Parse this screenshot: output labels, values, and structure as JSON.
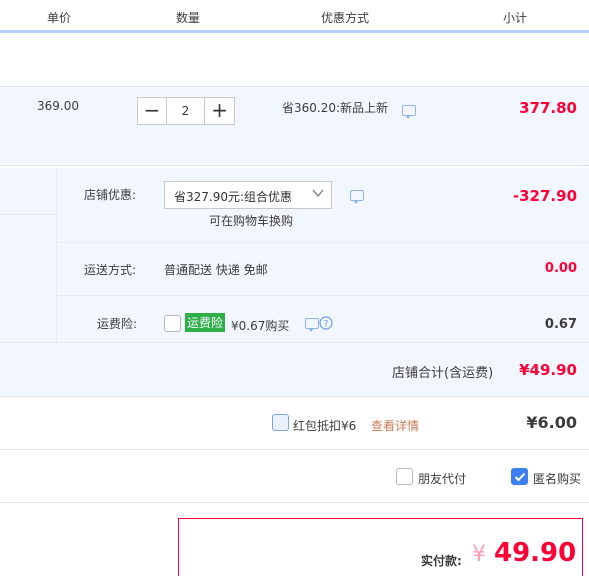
{
  "header": {
    "col_unit_price": "单价",
    "col_quantity": "数量",
    "col_discount": "优惠方式",
    "col_subtotal": "小计"
  },
  "item": {
    "unit_price": "369.00",
    "quantity": "2",
    "minus_label": "−",
    "plus_label": "+",
    "discount_text": "省360.20:新品上新",
    "subtotal": "377.80"
  },
  "shop": {
    "discount_label": "店铺优惠:",
    "discount_selected": "省327.90元:组合优惠",
    "discount_hint": "可在购物车换购",
    "discount_amount": "-327.90",
    "shipping_label": "运送方式:",
    "shipping_value": "普通配送 快递 免邮",
    "shipping_amount": "0.00",
    "insurance_label": "运费险:",
    "insurance_badge": "运费险",
    "insurance_price": "¥0.67购买",
    "insurance_amount": "0.67",
    "total_label": "店铺合计(含运费)",
    "total_amount": "¥49.90"
  },
  "redpacket": {
    "label": "红包抵扣¥6",
    "details_link": "查看详情",
    "amount": "¥6.00"
  },
  "options": {
    "friend_pay_label": "朋友代付",
    "anonymous_label": "匿名购买",
    "friend_pay_checked": false,
    "anonymous_checked": true
  },
  "payment": {
    "label": "实付款:",
    "currency": "¥",
    "amount": "49.90"
  },
  "icons": {
    "message": "message-icon",
    "help": "help-circle-icon",
    "dropdown": "chevron-down-icon",
    "check": "check-icon"
  },
  "colors": {
    "price_red": "#ff0036",
    "header_border": "#b2d1ff",
    "row_bg": "#f2f7ff",
    "insurance_green": "#2fae4a",
    "check_blue": "#3d7ef0",
    "link_orange": "#c87b54"
  }
}
